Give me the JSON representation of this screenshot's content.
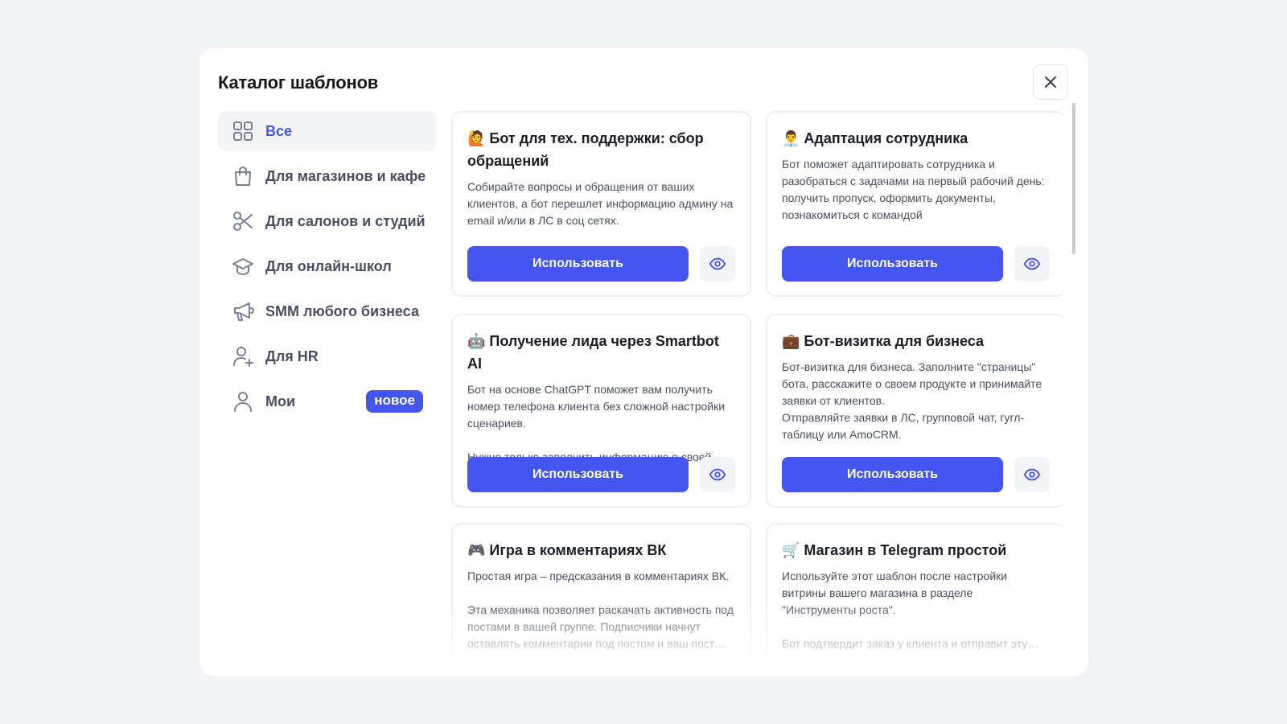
{
  "modal": {
    "title": "Каталог шаблонов",
    "close_icon": "close-icon"
  },
  "sidebar": {
    "items": [
      {
        "label": "Все",
        "icon": "grid-icon",
        "active": true
      },
      {
        "label": "Для магазинов и кафе",
        "icon": "shopping-bag-icon"
      },
      {
        "label": "Для салонов и студий",
        "icon": "scissors-icon"
      },
      {
        "label": "Для онлайн-школ",
        "icon": "graduation-cap-icon"
      },
      {
        "label": "SMM любого бизнеса",
        "icon": "megaphone-icon"
      },
      {
        "label": "Для HR",
        "icon": "user-plus-icon"
      },
      {
        "label": "Мои",
        "icon": "user-icon",
        "badge": "новое"
      }
    ]
  },
  "cards": [
    {
      "title": "🙋 Бот для тех. поддержки: сбор обращений",
      "description": "Собирайте вопросы и обращения от ваших клиентов, а бот перешлет информацию админу на email и/или в ЛС в соц сетях.",
      "use_label": "Использовать",
      "preview_icon": "eye-icon"
    },
    {
      "title": "👨‍💼 Адаптация сотрудника",
      "description": "Бот поможет адаптировать сотрудника и разобраться с задачами на первый рабочий день: получить пропуск, оформить документы, познакомиться с командой",
      "use_label": "Использовать",
      "preview_icon": "eye-icon"
    },
    {
      "title": "🤖 Получение лида через Smartbot AI",
      "description": "Бот на основе ChatGPT поможет вам получить номер телефона клиента без сложной настройки сценариев.\n\nНужно только заполнить информацию о своей…",
      "use_label": "Использовать",
      "preview_icon": "eye-icon"
    },
    {
      "title": "💼 Бот-визитка для бизнеса",
      "description": "Бот-визитка для бизнеса. Заполните \"страницы\" бота, расскажите о своем продукте и принимайте заявки от клиентов.\nОтправляйте заявки в ЛС, групповой чат, гугл-таблицу или AmoCRM.",
      "use_label": "Использовать",
      "preview_icon": "eye-icon"
    },
    {
      "title": "🎮 Игра в комментариях ВК",
      "description": "Простая игра – предсказания в комментариях ВК.\n\nЭта механика позволяет раскачать активность под постами в вашей группе. Подписчики начнут оставлять комментарии под постом и ваш пост…"
    },
    {
      "title": "🛒 Магазин в Telegram простой",
      "description": "Используйте этот шаблон после настройки витрины вашего магазина в разделе \"Инструменты роста\".\n\nБот подтвердит заказ у клиента и отправит эту…"
    }
  ]
}
